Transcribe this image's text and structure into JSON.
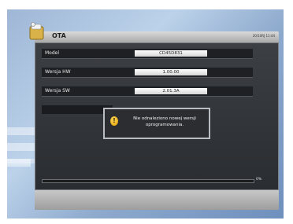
{
  "window": {
    "title": "OTA",
    "clock": "20/10RJ 11:44"
  },
  "fields": [
    {
      "label": "Model",
      "value": "CD45D831"
    },
    {
      "label": "Wersja HW",
      "value": "1.00.00"
    },
    {
      "label": "Wersja SW",
      "value": "2.01.3A"
    }
  ],
  "dialog": {
    "message": "Nie odnaleziono nowej wersji oprogramowania.",
    "icon": "warning-icon"
  },
  "progress": {
    "percent_label": "0%",
    "value": 0
  },
  "colors": {
    "panel": "#2f3236",
    "titlebar": "#a9a9a9",
    "warning": "#e3a100"
  }
}
